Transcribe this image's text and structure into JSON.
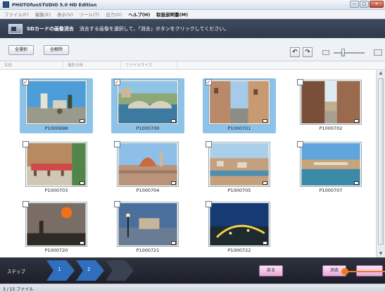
{
  "window": {
    "title": "PHOTOfunSTUDIO 5.0 HD Edition",
    "buttons": [
      "—",
      "□",
      "×"
    ]
  },
  "menu": [
    {
      "label": "ファイル(F)",
      "enabled": false
    },
    {
      "label": "編集(E)",
      "enabled": false
    },
    {
      "label": "表示(V)",
      "enabled": false
    },
    {
      "label": "ツール(T)",
      "enabled": false
    },
    {
      "label": "出力(O)",
      "enabled": false
    },
    {
      "label": "ヘルプ(H)",
      "enabled": true
    },
    {
      "label": "取扱説明書(M)",
      "enabled": true
    }
  ],
  "instruction": {
    "mode": "SDカードの画像消去",
    "text": "消去する画像を選択して、「消去」ボタンをクリックしてください。"
  },
  "toolbar": {
    "select_all": "全選択",
    "deselect_all": "全解除",
    "rotate_left": "↶",
    "rotate_right": "↷"
  },
  "columns": [
    "名前",
    "撮影日時",
    "ファイルサイズ"
  ],
  "photos": [
    {
      "name": "P1000698",
      "selected": true,
      "scene": "plaza"
    },
    {
      "name": "P1000700",
      "selected": true,
      "scene": "bridge"
    },
    {
      "name": "P1000701",
      "selected": true,
      "scene": "street"
    },
    {
      "name": "P1000702",
      "selected": false,
      "scene": "alley"
    },
    {
      "name": "P1000703",
      "selected": false,
      "scene": "cafe"
    },
    {
      "name": "P1000704",
      "selected": false,
      "scene": "dome"
    },
    {
      "name": "P1000705",
      "selected": false,
      "scene": "city"
    },
    {
      "name": "P1000707",
      "selected": false,
      "scene": "river"
    },
    {
      "name": "P1000720",
      "selected": false,
      "scene": "sunset"
    },
    {
      "name": "P1000721",
      "selected": false,
      "scene": "terrace"
    },
    {
      "name": "P1000722",
      "selected": false,
      "scene": "night"
    }
  ],
  "steps": {
    "label": "ステップ",
    "items": [
      "1",
      "2"
    ]
  },
  "actions": {
    "back": "戻る",
    "erase": "消去"
  },
  "status": {
    "count": "3 / 15 ファイル"
  },
  "colors": {
    "selection": "#8cc3ea",
    "header": "#2e394a",
    "accent": "#f07c18",
    "step": "#2f6fbd"
  }
}
